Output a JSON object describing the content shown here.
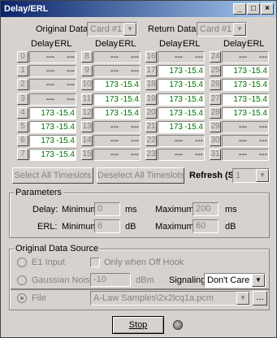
{
  "window": {
    "title": "Delay/ERL",
    "minimize": "_",
    "maximize": "□",
    "close": "×"
  },
  "top": {
    "original_label": "Original Data",
    "original_value": "Card #1",
    "return_label": "Return Data",
    "return_value": "Card #1"
  },
  "grid": {
    "header_delay": "Delay",
    "header_erl": "ERL",
    "columns": [
      [
        {
          "ts": "0",
          "delay": "---",
          "erl": "---",
          "active": false
        },
        {
          "ts": "1",
          "delay": "---",
          "erl": "---",
          "active": false
        },
        {
          "ts": "2",
          "delay": "---",
          "erl": "---",
          "active": false
        },
        {
          "ts": "3",
          "delay": "---",
          "erl": "---",
          "active": false
        },
        {
          "ts": "4",
          "delay": "173",
          "erl": "-15.4",
          "active": true
        },
        {
          "ts": "5",
          "delay": "173",
          "erl": "-15.4",
          "active": true
        },
        {
          "ts": "6",
          "delay": "173",
          "erl": "-15.4",
          "active": true
        },
        {
          "ts": "7",
          "delay": "173",
          "erl": "-15.4",
          "active": true
        }
      ],
      [
        {
          "ts": "8",
          "delay": "---",
          "erl": "---",
          "active": false
        },
        {
          "ts": "9",
          "delay": "---",
          "erl": "---",
          "active": false
        },
        {
          "ts": "10",
          "delay": "173",
          "erl": "-15.4",
          "active": true
        },
        {
          "ts": "11",
          "delay": "173",
          "erl": "-15.4",
          "active": true
        },
        {
          "ts": "12",
          "delay": "173",
          "erl": "-15.4",
          "active": true
        },
        {
          "ts": "13",
          "delay": "---",
          "erl": "---",
          "active": false
        },
        {
          "ts": "14",
          "delay": "---",
          "erl": "---",
          "active": false
        },
        {
          "ts": "15",
          "delay": "---",
          "erl": "---",
          "active": false
        }
      ],
      [
        {
          "ts": "16",
          "delay": "---",
          "erl": "---",
          "active": false
        },
        {
          "ts": "17",
          "delay": "173",
          "erl": "-15.4",
          "active": true
        },
        {
          "ts": "18",
          "delay": "173",
          "erl": "-15.4",
          "active": true
        },
        {
          "ts": "19",
          "delay": "173",
          "erl": "-15.4",
          "active": true
        },
        {
          "ts": "20",
          "delay": "173",
          "erl": "-15.4",
          "active": true
        },
        {
          "ts": "21",
          "delay": "173",
          "erl": "-15.4",
          "active": true
        },
        {
          "ts": "22",
          "delay": "---",
          "erl": "---",
          "active": false
        },
        {
          "ts": "23",
          "delay": "---",
          "erl": "---",
          "active": false
        }
      ],
      [
        {
          "ts": "24",
          "delay": "---",
          "erl": "---",
          "active": false
        },
        {
          "ts": "25",
          "delay": "173",
          "erl": "-15.4",
          "active": true
        },
        {
          "ts": "26",
          "delay": "173",
          "erl": "-15.4",
          "active": true
        },
        {
          "ts": "27",
          "delay": "173",
          "erl": "-15.4",
          "active": true
        },
        {
          "ts": "28",
          "delay": "173",
          "erl": "-15.4",
          "active": true
        },
        {
          "ts": "29",
          "delay": "---",
          "erl": "---",
          "active": false
        },
        {
          "ts": "30",
          "delay": "---",
          "erl": "---",
          "active": false
        },
        {
          "ts": "31",
          "delay": "---",
          "erl": "---",
          "active": false
        }
      ]
    ]
  },
  "actions": {
    "select_all": "Select All Timeslots",
    "deselect_all": "Deselect All Timeslots",
    "refresh_label": "Refresh (Sec)",
    "refresh_value": "1"
  },
  "parameters": {
    "title": "Parameters",
    "delay_label": "Delay:",
    "erl_label": "ERL:",
    "minimum": "Minimum",
    "maximum": "Maximum",
    "delay_min": "0",
    "delay_max": "200",
    "delay_unit": "ms",
    "erl_min": "6",
    "erl_max": "60",
    "erl_unit": "dB"
  },
  "source": {
    "title": "Original Data Source",
    "e1_input": "E1 Input",
    "only_offhook": "Only when Off Hook",
    "gaussian": "Gaussian Noise",
    "gaussian_value": "-10",
    "dbm": "dBm",
    "signaling_label": "Signaling",
    "signaling_value": "Don't Care",
    "file": "File",
    "file_value": "A-Law Samples\\2x2lcq1a.pcm",
    "browse": "..."
  },
  "footer": {
    "stop": "Stop"
  }
}
